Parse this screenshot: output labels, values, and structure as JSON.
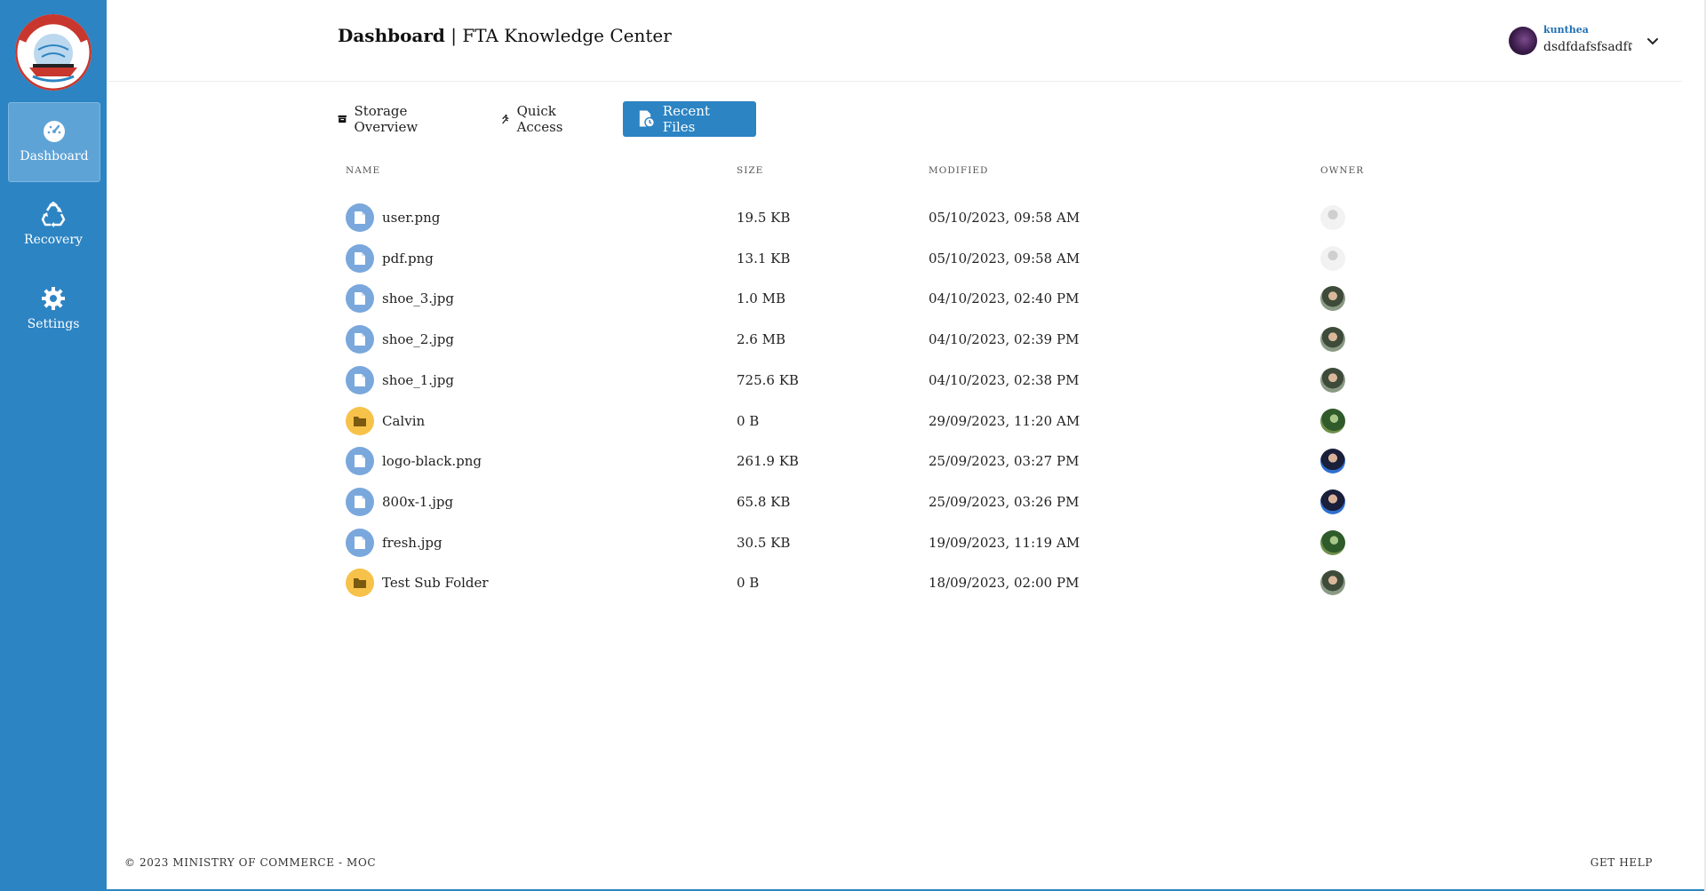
{
  "app": {
    "title_bold": "Dashboard",
    "title_sep": " | ",
    "title_rest": "FTA Knowledge Center"
  },
  "sidebar": {
    "items": [
      {
        "label": "Dashboard",
        "icon": "speedometer-icon",
        "active": true
      },
      {
        "label": "Recovery",
        "icon": "recycle-icon",
        "active": false
      },
      {
        "label": "Settings",
        "icon": "gear-icon",
        "active": false
      }
    ]
  },
  "user": {
    "name": "kunthea",
    "email": "dsdfdafsfsadfព"
  },
  "tabs": [
    {
      "label": "Storage Overview",
      "icon": "archive-icon"
    },
    {
      "label": "Quick Access",
      "icon": "running-icon"
    },
    {
      "label": "Recent Files",
      "icon": "file-clock-icon",
      "active": true
    }
  ],
  "table": {
    "headers": {
      "name": "NAME",
      "size": "SIZE",
      "modified": "MODIFIED",
      "owner": "OWNER"
    },
    "rows": [
      {
        "name": "user.png",
        "type": "file",
        "size": "19.5 KB",
        "modified": "05/10/2023, 09:58 AM",
        "owner": "default-avatar"
      },
      {
        "name": "pdf.png",
        "type": "file",
        "size": "13.1 KB",
        "modified": "05/10/2023, 09:58 AM",
        "owner": "default-avatar"
      },
      {
        "name": "shoe_3.jpg",
        "type": "file",
        "size": "1.0 MB",
        "modified": "04/10/2023, 02:40 PM",
        "owner": "photo-avatar-a"
      },
      {
        "name": "shoe_2.jpg",
        "type": "file",
        "size": "2.6 MB",
        "modified": "04/10/2023, 02:39 PM",
        "owner": "photo-avatar-a"
      },
      {
        "name": "shoe_1.jpg",
        "type": "file",
        "size": "725.6 KB",
        "modified": "04/10/2023, 02:38 PM",
        "owner": "photo-avatar-a"
      },
      {
        "name": "Calvin",
        "type": "folder",
        "size": "0 B",
        "modified": "29/09/2023, 11:20 AM",
        "owner": "photo-avatar-b"
      },
      {
        "name": "logo-black.png",
        "type": "file",
        "size": "261.9 KB",
        "modified": "25/09/2023, 03:27 PM",
        "owner": "photo-avatar-c"
      },
      {
        "name": "800x-1.jpg",
        "type": "file",
        "size": "65.8 KB",
        "modified": "25/09/2023, 03:26 PM",
        "owner": "photo-avatar-c"
      },
      {
        "name": "fresh.jpg",
        "type": "file",
        "size": "30.5 KB",
        "modified": "19/09/2023, 11:19 AM",
        "owner": "photo-avatar-b"
      },
      {
        "name": "Test Sub Folder",
        "type": "folder",
        "size": "0 B",
        "modified": "18/09/2023, 02:00 PM",
        "owner": "photo-avatar-a"
      }
    ]
  },
  "footer": {
    "copyright": "© 2023 MINISTRY OF COMMERCE - MOC",
    "help": "GET HELP"
  },
  "colors": {
    "sidebar": "#2c84c3",
    "file_icon_bg": "#7aa8dc",
    "folder_icon_bg": "#f7c24a",
    "accent": "#2c84c3"
  }
}
